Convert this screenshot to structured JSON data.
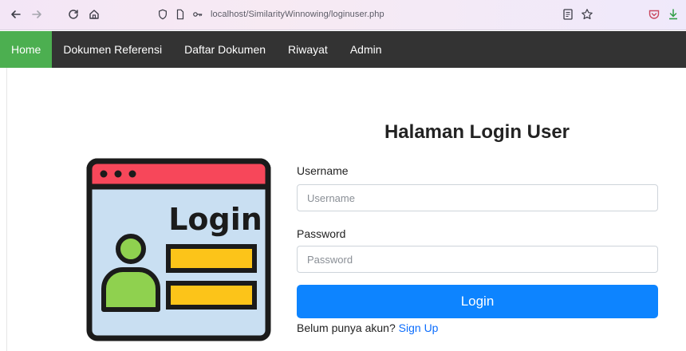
{
  "browser": {
    "url": "localhost/SimilarityWinnowing/loginuser.php",
    "icons": [
      "back-icon",
      "forward-icon",
      "reload-icon",
      "home-icon",
      "shield-icon",
      "page-icon",
      "key-icon",
      "reader-icon",
      "bookmark-star-icon",
      "pocket-icon",
      "download-icon"
    ]
  },
  "navbar": {
    "items": [
      {
        "label": "Home",
        "active": true
      },
      {
        "label": "Dokumen Referensi",
        "active": false
      },
      {
        "label": "Daftar Dokumen",
        "active": false
      },
      {
        "label": "Riwayat",
        "active": false
      },
      {
        "label": "Admin",
        "active": false
      }
    ],
    "colors": {
      "bar": "#333333",
      "active": "#4caf50"
    }
  },
  "illustration": {
    "text": "Login"
  },
  "form": {
    "title": "Halaman Login User",
    "username_label": "Username",
    "username_placeholder": "Username",
    "password_label": "Password",
    "password_placeholder": "Password",
    "submit_label": "Login",
    "signup_prompt": "Belum punya akun?",
    "signup_link": "Sign Up",
    "colors": {
      "button": "#0d84ff",
      "link": "#0d6efd"
    }
  }
}
